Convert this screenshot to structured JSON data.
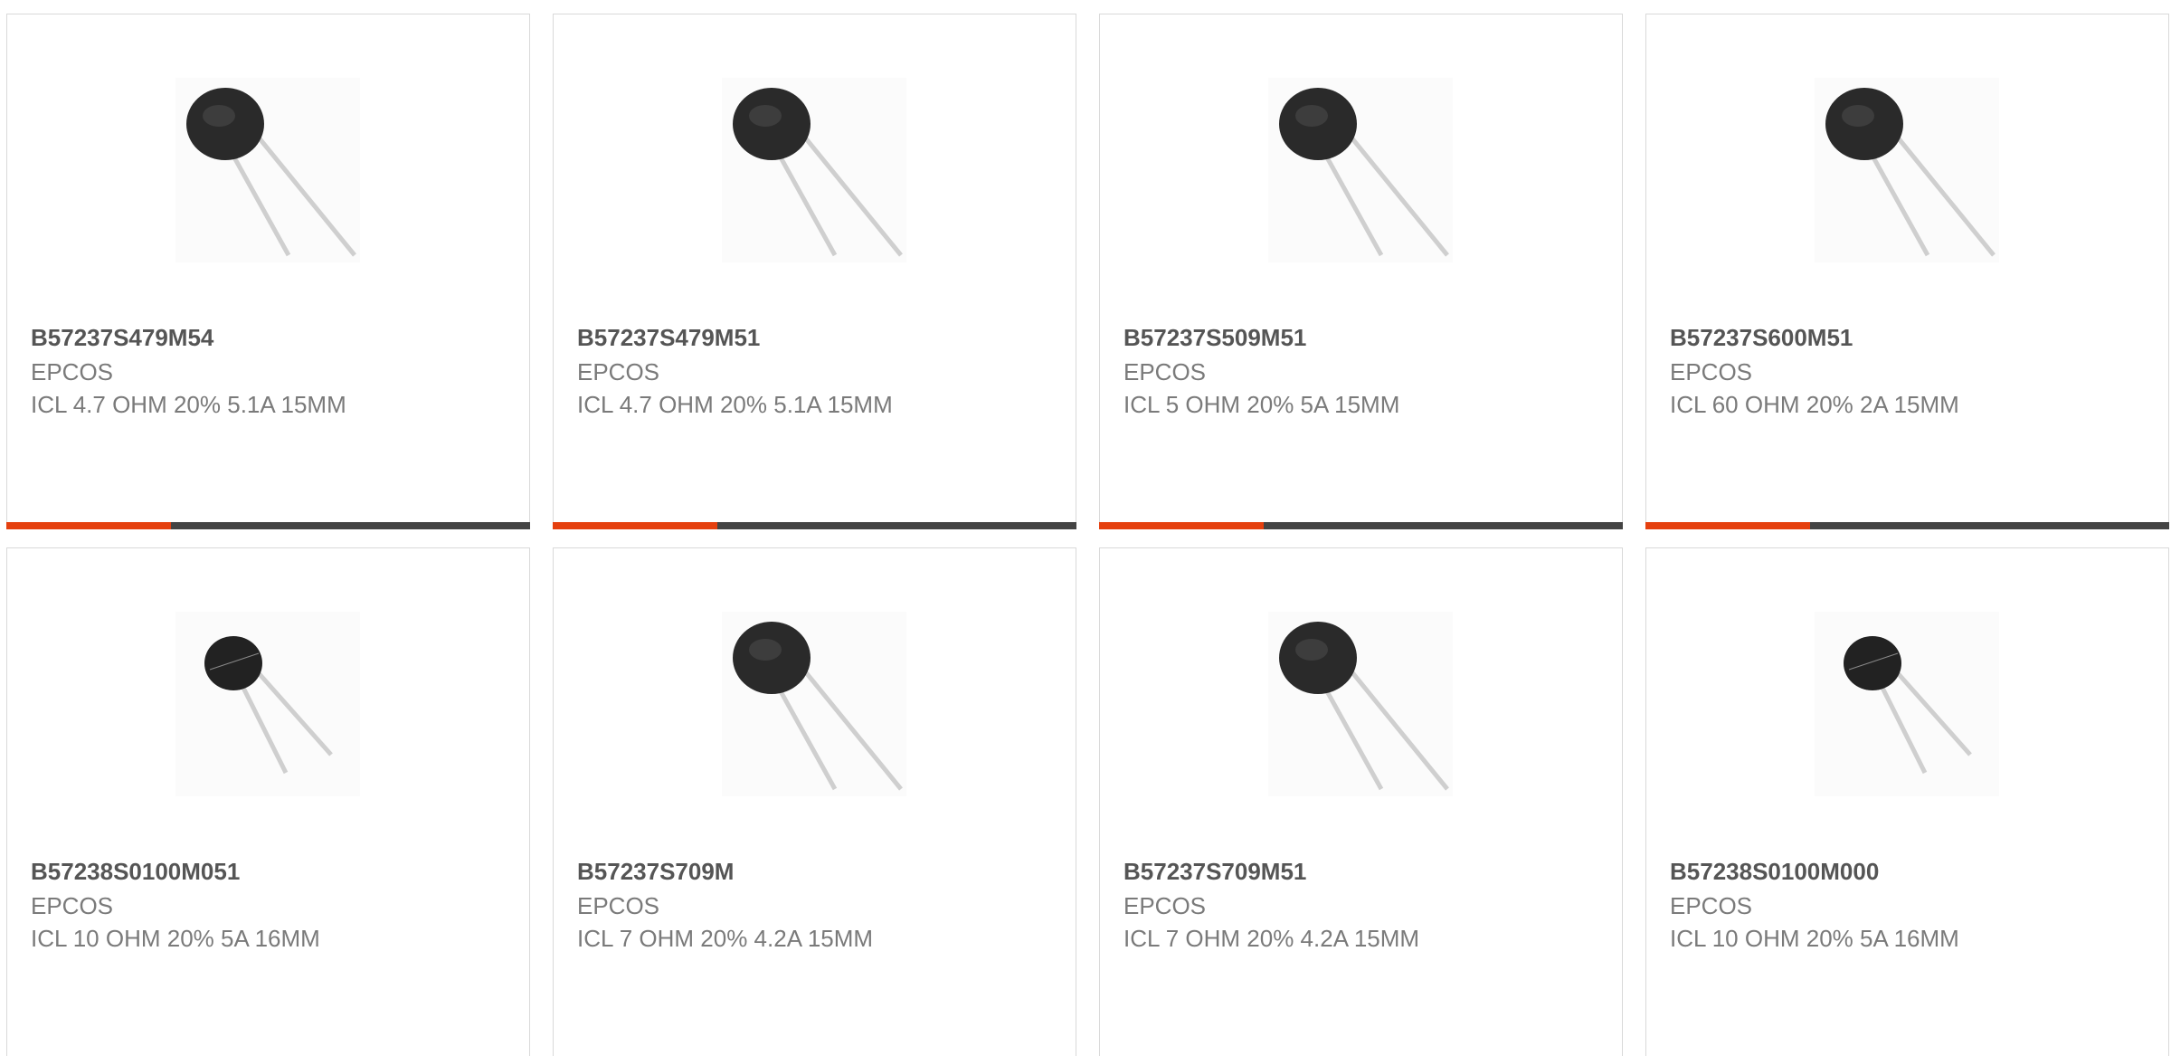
{
  "colors": {
    "accent": "#e5400f",
    "bar_track": "#444444",
    "part_text": "#555555",
    "meta_text": "#7a7a7a",
    "card_border": "#d9d9d9"
  },
  "products": [
    {
      "part": "B57237S479M54",
      "maker": "EPCOS",
      "desc": "ICL 4.7 OHM 20% 5.1A 15MM",
      "image": "thermistor-icon"
    },
    {
      "part": "B57237S479M51",
      "maker": "EPCOS",
      "desc": "ICL 4.7 OHM 20% 5.1A 15MM",
      "image": "thermistor-icon"
    },
    {
      "part": "B57237S509M51",
      "maker": "EPCOS",
      "desc": "ICL 5 OHM 20% 5A 15MM",
      "image": "thermistor-icon"
    },
    {
      "part": "B57237S600M51",
      "maker": "EPCOS",
      "desc": "ICL 60 OHM 20% 2A 15MM",
      "image": "thermistor-icon"
    },
    {
      "part": "B57238S0100M051",
      "maker": "EPCOS",
      "desc": "ICL 10 OHM 20% 5A 16MM",
      "image": "thermistor-icon"
    },
    {
      "part": "B57237S709M",
      "maker": "EPCOS",
      "desc": "ICL 7 OHM 20% 4.2A 15MM",
      "image": "thermistor-icon"
    },
    {
      "part": "B57237S709M51",
      "maker": "EPCOS",
      "desc": "ICL 7 OHM 20% 4.2A 15MM",
      "image": "thermistor-icon"
    },
    {
      "part": "B57238S0100M000",
      "maker": "EPCOS",
      "desc": "ICL 10 OHM 20% 5A 16MM",
      "image": "thermistor-icon"
    }
  ],
  "progress_bars": [
    {
      "fraction": 0.315
    },
    {
      "fraction": 0.315
    },
    {
      "fraction": 0.315
    },
    {
      "fraction": 0.315
    }
  ]
}
